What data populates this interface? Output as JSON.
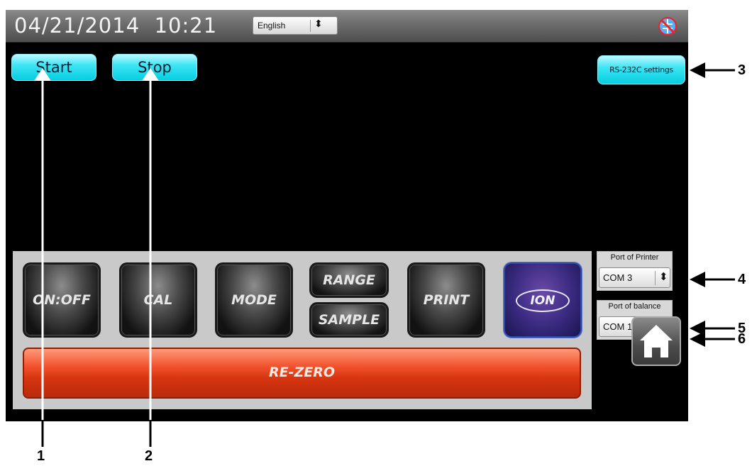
{
  "status_bar": {
    "datetime": "04/21/2014  10:21",
    "language": "English",
    "network_icon": "network-disconnected-icon"
  },
  "buttons": {
    "start": "Start",
    "stop": "Stop",
    "rs232c": "RS-232C settings"
  },
  "keypad": {
    "on_off": "ON:OFF",
    "cal": "CAL",
    "mode": "MODE",
    "range": "RANGE",
    "sample": "SAMPLE",
    "print": "PRINT",
    "ion": "ION",
    "rezero": "RE-ZERO"
  },
  "ports": {
    "printer_label": "Port of Printer",
    "printer_value": "COM 3",
    "balance_label": "Port of balance",
    "balance_value": "COM 1"
  },
  "home_icon": "home-icon",
  "callouts": [
    "1",
    "2",
    "3",
    "4",
    "5",
    "6"
  ],
  "colors": {
    "button_cyan": "#05cde0",
    "rezero_red": "#d8350f",
    "ion_purple": "#3a2a80",
    "panel_gray": "#c9c9c9"
  }
}
